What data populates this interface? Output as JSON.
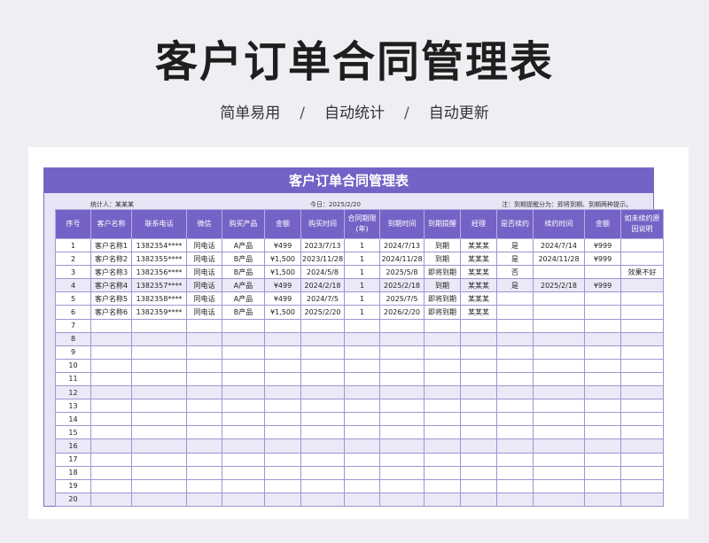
{
  "hero": {
    "title": "客户订单合同管理表",
    "tags": [
      "简单易用",
      "自动统计",
      "自动更新"
    ],
    "separator": "/"
  },
  "sheet": {
    "title": "客户订单合同管理表",
    "stat_label": "统计人：",
    "stat_value": "某某某",
    "today_label": "今日：",
    "today_value": "2025/2/20",
    "note": "注：到期提醒分为：即将到期、到期两种提示。"
  },
  "columns": [
    "序号",
    "客户名称",
    "联系电话",
    "微信",
    "购买产品",
    "金额",
    "购买时间",
    "合同期限(年)",
    "到期时间",
    "到期提醒",
    "经理",
    "是否续约",
    "续约时间",
    "金额",
    "如未续约原因说明"
  ],
  "rows": [
    [
      "1",
      "客户名称1",
      "1382354****",
      "同电话",
      "A产品",
      "¥499",
      "2023/7/13",
      "1",
      "2024/7/13",
      "到期",
      "某某某",
      "是",
      "2024/7/14",
      "¥999",
      ""
    ],
    [
      "2",
      "客户名称2",
      "1382355****",
      "同电话",
      "B产品",
      "¥1,500",
      "2023/11/28",
      "1",
      "2024/11/28",
      "到期",
      "某某某",
      "是",
      "2024/11/28",
      "¥999",
      ""
    ],
    [
      "3",
      "客户名称3",
      "1382356****",
      "同电话",
      "B产品",
      "¥1,500",
      "2024/5/8",
      "1",
      "2025/5/8",
      "即将到期",
      "某某某",
      "否",
      "",
      "",
      "效果不好"
    ],
    [
      "4",
      "客户名称4",
      "1382357****",
      "同电话",
      "A产品",
      "¥499",
      "2024/2/18",
      "1",
      "2025/2/18",
      "到期",
      "某某某",
      "是",
      "2025/2/18",
      "¥999",
      ""
    ],
    [
      "5",
      "客户名称5",
      "1382358****",
      "同电话",
      "A产品",
      "¥499",
      "2024/7/5",
      "1",
      "2025/7/5",
      "即将到期",
      "某某某",
      "",
      "",
      "",
      ""
    ],
    [
      "6",
      "客户名称6",
      "1382359****",
      "同电话",
      "B产品",
      "¥1,500",
      "2025/2/20",
      "1",
      "2026/2/20",
      "即将到期",
      "某某某",
      "",
      "",
      "",
      ""
    ],
    [
      "7",
      "",
      "",
      "",
      "",
      "",
      "",
      "",
      "",
      "",
      "",
      "",
      "",
      "",
      ""
    ],
    [
      "8",
      "",
      "",
      "",
      "",
      "",
      "",
      "",
      "",
      "",
      "",
      "",
      "",
      "",
      ""
    ],
    [
      "9",
      "",
      "",
      "",
      "",
      "",
      "",
      "",
      "",
      "",
      "",
      "",
      "",
      "",
      ""
    ],
    [
      "10",
      "",
      "",
      "",
      "",
      "",
      "",
      "",
      "",
      "",
      "",
      "",
      "",
      "",
      ""
    ],
    [
      "11",
      "",
      "",
      "",
      "",
      "",
      "",
      "",
      "",
      "",
      "",
      "",
      "",
      "",
      ""
    ],
    [
      "12",
      "",
      "",
      "",
      "",
      "",
      "",
      "",
      "",
      "",
      "",
      "",
      "",
      "",
      ""
    ],
    [
      "13",
      "",
      "",
      "",
      "",
      "",
      "",
      "",
      "",
      "",
      "",
      "",
      "",
      "",
      ""
    ],
    [
      "14",
      "",
      "",
      "",
      "",
      "",
      "",
      "",
      "",
      "",
      "",
      "",
      "",
      "",
      ""
    ],
    [
      "15",
      "",
      "",
      "",
      "",
      "",
      "",
      "",
      "",
      "",
      "",
      "",
      "",
      "",
      ""
    ],
    [
      "16",
      "",
      "",
      "",
      "",
      "",
      "",
      "",
      "",
      "",
      "",
      "",
      "",
      "",
      ""
    ],
    [
      "17",
      "",
      "",
      "",
      "",
      "",
      "",
      "",
      "",
      "",
      "",
      "",
      "",
      "",
      ""
    ],
    [
      "18",
      "",
      "",
      "",
      "",
      "",
      "",
      "",
      "",
      "",
      "",
      "",
      "",
      "",
      ""
    ],
    [
      "19",
      "",
      "",
      "",
      "",
      "",
      "",
      "",
      "",
      "",
      "",
      "",
      "",
      "",
      ""
    ],
    [
      "20",
      "",
      "",
      "",
      "",
      "",
      "",
      "",
      "",
      "",
      "",
      "",
      "",
      "",
      ""
    ]
  ],
  "colors": {
    "accent": "#7562c6",
    "sheet_bg": "#e7e5f5",
    "row_alt": "#ebe9f7",
    "page_bg": "#efeff3"
  }
}
